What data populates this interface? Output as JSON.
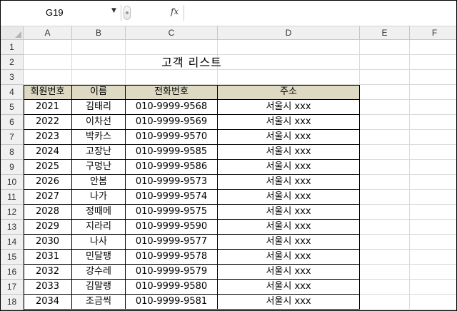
{
  "formula_bar": {
    "name_box": "G19",
    "fx": "fx",
    "formula": ""
  },
  "columns": [
    "A",
    "B",
    "C",
    "D",
    "E",
    "F"
  ],
  "rows": [
    "1",
    "2",
    "3",
    "4",
    "5",
    "6",
    "7",
    "8",
    "9",
    "10",
    "11",
    "12",
    "13",
    "14",
    "15",
    "16",
    "17",
    "18"
  ],
  "title": "고객 리스트",
  "table": {
    "headers": [
      "회원번호",
      "이름",
      "전화번호",
      "주소"
    ],
    "rows": [
      [
        "2021",
        "김태리",
        "010-9999-9568",
        "서울시 xxx"
      ],
      [
        "2022",
        "이차선",
        "010-9999-9569",
        "서울시 xxx"
      ],
      [
        "2023",
        "박카스",
        "010-9999-9570",
        "서울시 xxx"
      ],
      [
        "2024",
        "고장난",
        "010-9999-9585",
        "서울시 xxx"
      ],
      [
        "2025",
        "구멍난",
        "010-9999-9586",
        "서울시 xxx"
      ],
      [
        "2026",
        "안봄",
        "010-9999-9573",
        "서울시 xxx"
      ],
      [
        "2027",
        "나가",
        "010-9999-9574",
        "서울시 xxx"
      ],
      [
        "2028",
        "정때메",
        "010-9999-9575",
        "서울시 xxx"
      ],
      [
        "2029",
        "지라리",
        "010-9999-9590",
        "서울시 xxx"
      ],
      [
        "2030",
        "나사",
        "010-9999-9577",
        "서울시 xxx"
      ],
      [
        "2031",
        "민달팽",
        "010-9999-9578",
        "서울시 xxx"
      ],
      [
        "2032",
        "강수레",
        "010-9999-9579",
        "서울시 xxx"
      ],
      [
        "2033",
        "김말랭",
        "010-9999-9580",
        "서울시 xxx"
      ],
      [
        "2034",
        "조금씩",
        "010-9999-9581",
        "서울시 xxx"
      ]
    ]
  },
  "colors": {
    "header_fill": "#ddd9c3",
    "grid_line": "#dadada",
    "heading_bg": "#f0f0f0"
  }
}
